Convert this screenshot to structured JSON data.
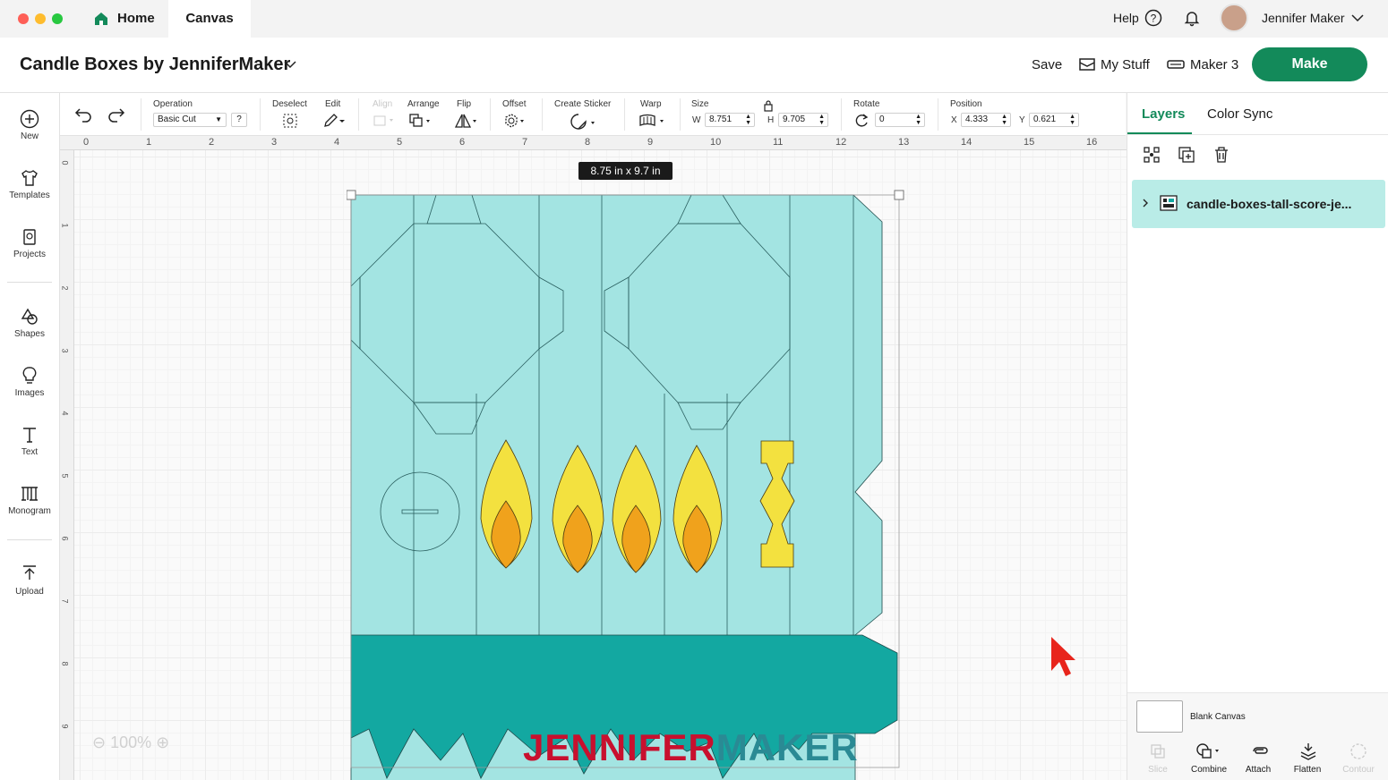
{
  "titlebar": {
    "tabs": [
      {
        "label": "Home"
      },
      {
        "label": "Canvas"
      }
    ]
  },
  "header": {
    "project_title": "Candle Boxes by JenniferMaker",
    "help": "Help",
    "user_name": "Jennifer Maker",
    "save": "Save",
    "my_stuff": "My Stuff",
    "machine": "Maker 3",
    "make": "Make"
  },
  "leftnav": {
    "items": [
      {
        "label": "New"
      },
      {
        "label": "Templates"
      },
      {
        "label": "Projects"
      },
      {
        "label": "Shapes"
      },
      {
        "label": "Images"
      },
      {
        "label": "Text"
      },
      {
        "label": "Monogram"
      },
      {
        "label": "Upload"
      }
    ]
  },
  "toolbar": {
    "operation_label": "Operation",
    "operation_value": "Basic Cut",
    "operation_help": "?",
    "deselect": "Deselect",
    "edit": "Edit",
    "align": "Align",
    "arrange": "Arrange",
    "flip": "Flip",
    "offset": "Offset",
    "create_sticker": "Create Sticker",
    "warp": "Warp",
    "size": "Size",
    "w_label": "W",
    "w_value": "8.751",
    "h_label": "H",
    "h_value": "9.705",
    "rotate": "Rotate",
    "rotate_value": "0",
    "position": "Position",
    "x_label": "X",
    "x_value": "4.333",
    "y_label": "Y",
    "y_value": "0.621"
  },
  "canvas": {
    "ruler_top": [
      "0",
      "1",
      "2",
      "3",
      "4",
      "5",
      "6",
      "7",
      "8",
      "9",
      "10",
      "11",
      "12",
      "13",
      "14",
      "15",
      "16"
    ],
    "ruler_left": [
      "0",
      "1",
      "2",
      "3",
      "4",
      "5",
      "6",
      "7",
      "8",
      "9"
    ],
    "size_tip": "8.75  in x 9.7  in",
    "zoom": "100%",
    "watermark_a": "JENNIFER",
    "watermark_b": "MAKER"
  },
  "rightpanel": {
    "tab_layers": "Layers",
    "tab_colorsync": "Color Sync",
    "layer_name": "candle-boxes-tall-score-je...",
    "blank_canvas": "Blank Canvas",
    "actions": [
      {
        "label": "Slice"
      },
      {
        "label": "Combine"
      },
      {
        "label": "Attach"
      },
      {
        "label": "Flatten"
      },
      {
        "label": "Contour"
      }
    ]
  },
  "colors": {
    "accent": "#138a5a",
    "light_teal": "#a3e4e2",
    "dark_teal": "#13a8a1",
    "yellow": "#f3e13f",
    "orange": "#f0a21c",
    "watermark_red": "#c8102e",
    "watermark_teal": "#2a8a94"
  }
}
